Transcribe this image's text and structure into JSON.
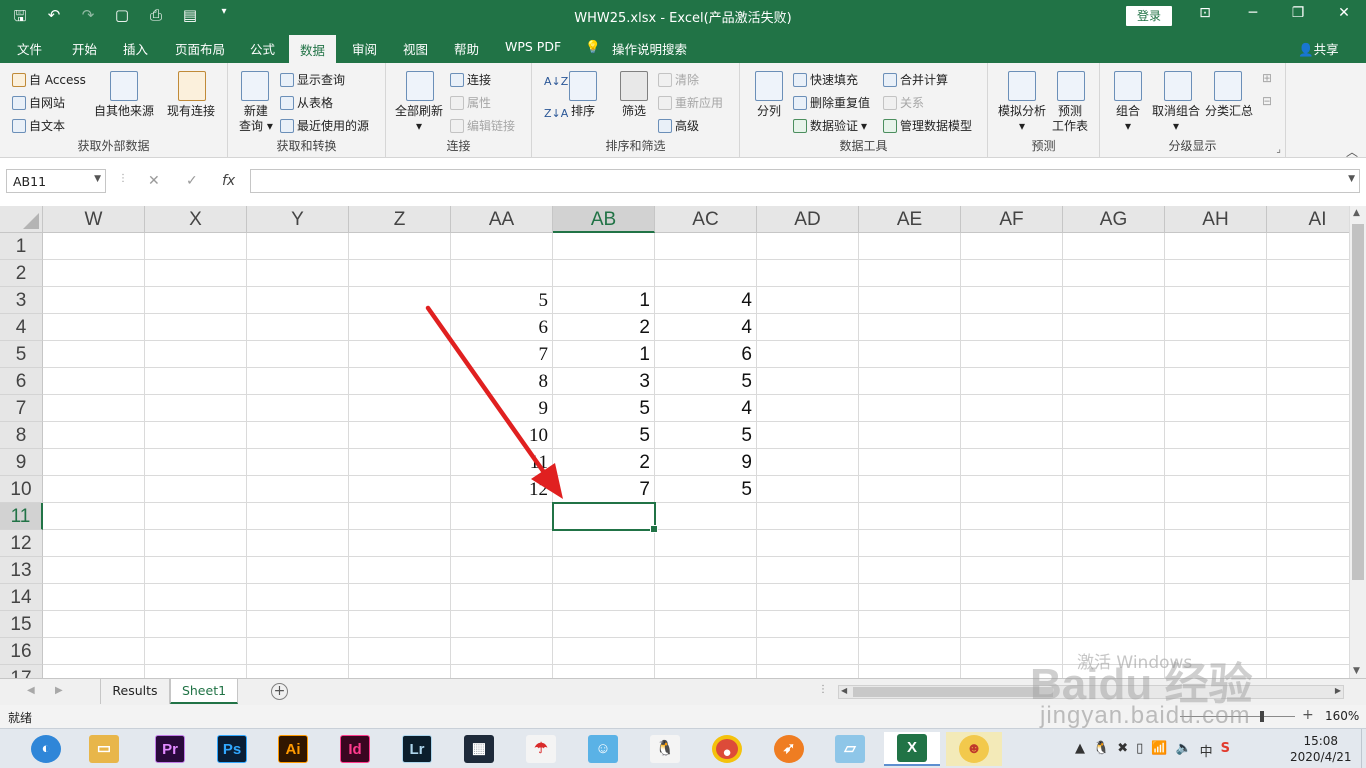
{
  "window": {
    "title": "WHW25.xlsx  -  Excel(产品激活失败)",
    "login_label": "登录",
    "share_label": "共享"
  },
  "tabs": [
    "文件",
    "开始",
    "插入",
    "页面布局",
    "公式",
    "数据",
    "审阅",
    "视图",
    "帮助",
    "WPS PDF",
    "操作说明搜索"
  ],
  "active_tab": "数据",
  "ribbon": {
    "get_external": {
      "label": "获取外部数据",
      "access": "自 Access",
      "web": "自网站",
      "text": "自文本",
      "other_sources": "自其他来源",
      "existing": "现有连接"
    },
    "get_transform": {
      "label": "获取和转换",
      "new_query_1": "新建",
      "new_query_2": "查询",
      "show_queries": "显示查询",
      "from_table": "从表格",
      "recent_sources": "最近使用的源"
    },
    "connections": {
      "label": "连接",
      "refresh_all": "全部刷新",
      "connections": "连接",
      "properties": "属性",
      "edit_links": "编辑链接"
    },
    "sort_filter": {
      "label": "排序和筛选",
      "sort": "排序",
      "filter": "筛选",
      "clear": "清除",
      "reapply": "重新应用",
      "advanced": "高级"
    },
    "data_tools": {
      "label": "数据工具",
      "text_to_columns": "分列",
      "flash_fill": "快速填充",
      "remove_duplicates": "删除重复值",
      "data_validation": "数据验证",
      "consolidate": "合并计算",
      "relationships": "关系",
      "data_model": "管理数据模型"
    },
    "forecast": {
      "label": "预测",
      "what_if": "模拟分析",
      "forecast_sheet_1": "预测",
      "forecast_sheet_2": "工作表"
    },
    "outline": {
      "label": "分级显示",
      "group": "组合",
      "ungroup": "取消组合",
      "subtotal": "分类汇总"
    }
  },
  "formula_bar": {
    "name_box": "AB11",
    "fx": "fx",
    "cancel": "✕",
    "enter": "✓",
    "formula": ""
  },
  "grid": {
    "columns": [
      "W",
      "X",
      "Y",
      "Z",
      "AA",
      "AB",
      "AC",
      "AD",
      "AE",
      "AF",
      "AG",
      "AH",
      "AI"
    ],
    "rows": [
      "1",
      "2",
      "3",
      "4",
      "5",
      "6",
      "7",
      "8",
      "9",
      "10",
      "11",
      "12",
      "13",
      "14",
      "15",
      "16",
      "17"
    ],
    "selected_column": "AB",
    "selected_row": "11",
    "col_AA": [
      "5",
      "6",
      "7",
      "8",
      "9",
      "10",
      "11",
      "12"
    ],
    "col_AB": [
      "1",
      "2",
      "1",
      "3",
      "5",
      "5",
      "2",
      "7"
    ],
    "col_AC": [
      "4",
      "4",
      "6",
      "5",
      "4",
      "5",
      "9",
      "5"
    ]
  },
  "sheets": [
    "Results",
    "Sheet1"
  ],
  "active_sheet": "Sheet1",
  "status": {
    "ready": "就绪",
    "zoom": "160%"
  },
  "watermark": {
    "logo": "Baidu 经验",
    "url": "jingyan.baidu.com",
    "activate": "激活 Windows"
  },
  "taskbar": {
    "apps": [
      "Pr",
      "Ps",
      "Ai",
      "Id",
      "Lr"
    ],
    "ime": "中",
    "time": "15:08",
    "date": "2020/4/21"
  },
  "colors": {
    "excel_green": "#217346",
    "arrow_red": "#e02020"
  }
}
